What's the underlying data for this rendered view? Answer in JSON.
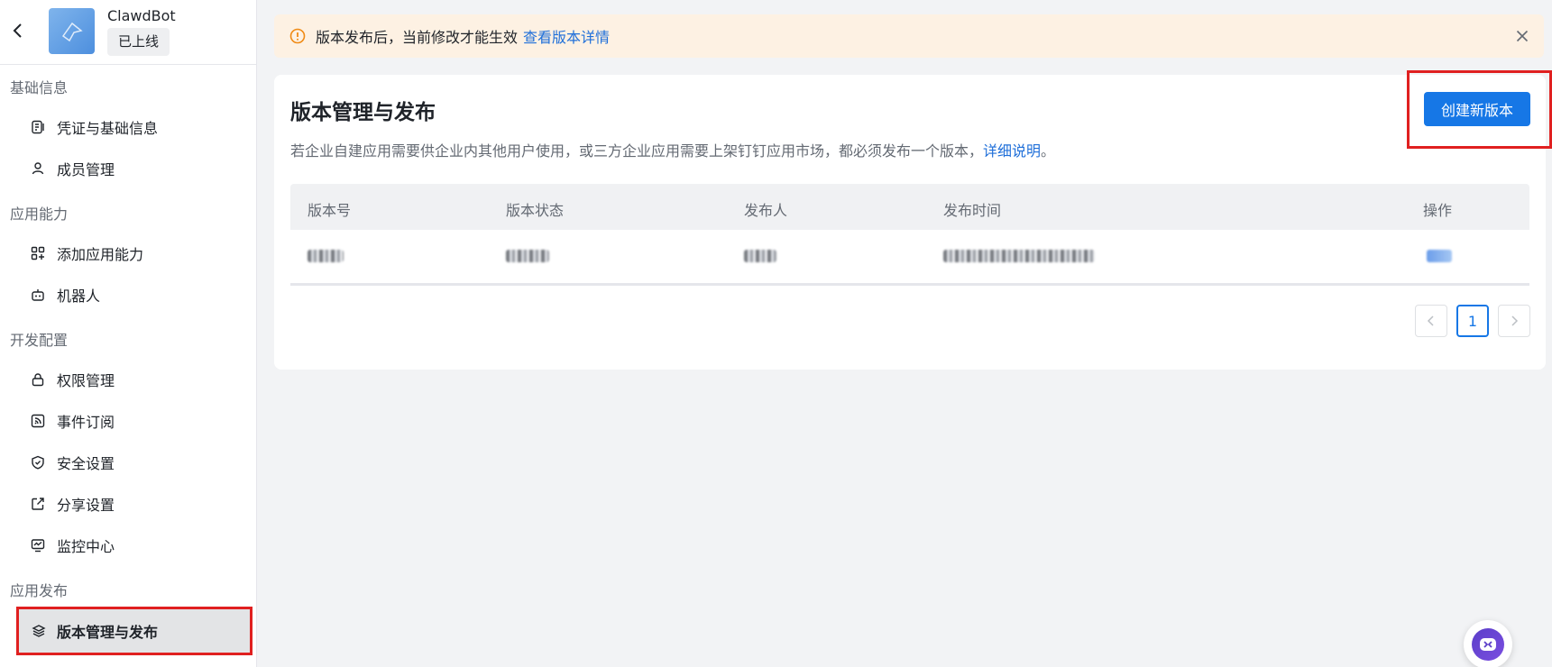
{
  "app": {
    "name": "ClawdBot",
    "status_badge": "已上线"
  },
  "sidebar": {
    "groups": [
      {
        "title": "基础信息",
        "items": [
          "凭证与基础信息",
          "成员管理"
        ]
      },
      {
        "title": "应用能力",
        "items": [
          "添加应用能力",
          "机器人"
        ]
      },
      {
        "title": "开发配置",
        "items": [
          "权限管理",
          "事件订阅",
          "安全设置",
          "分享设置",
          "监控中心"
        ]
      },
      {
        "title": "应用发布",
        "items": [
          "版本管理与发布"
        ]
      }
    ],
    "active_item": "版本管理与发布"
  },
  "notice": {
    "text": "版本发布后，当前修改才能生效",
    "link": "查看版本详情",
    "color": "#fdf1e3"
  },
  "main": {
    "title": "版本管理与发布",
    "create_button": "创建新版本",
    "description": "若企业自建应用需要供企业内其他用户使用，或三方企业应用需要上架钉钉应用市场，都必须发布一个版本，",
    "description_link": "详细说明",
    "description_end": "。",
    "table": {
      "columns": [
        "版本号",
        "版本状态",
        "发布人",
        "发布时间",
        "操作"
      ]
    },
    "pagination": {
      "current_page": "1"
    }
  },
  "colors": {
    "accent": "#1677e6",
    "highlight_border": "#e02020"
  }
}
